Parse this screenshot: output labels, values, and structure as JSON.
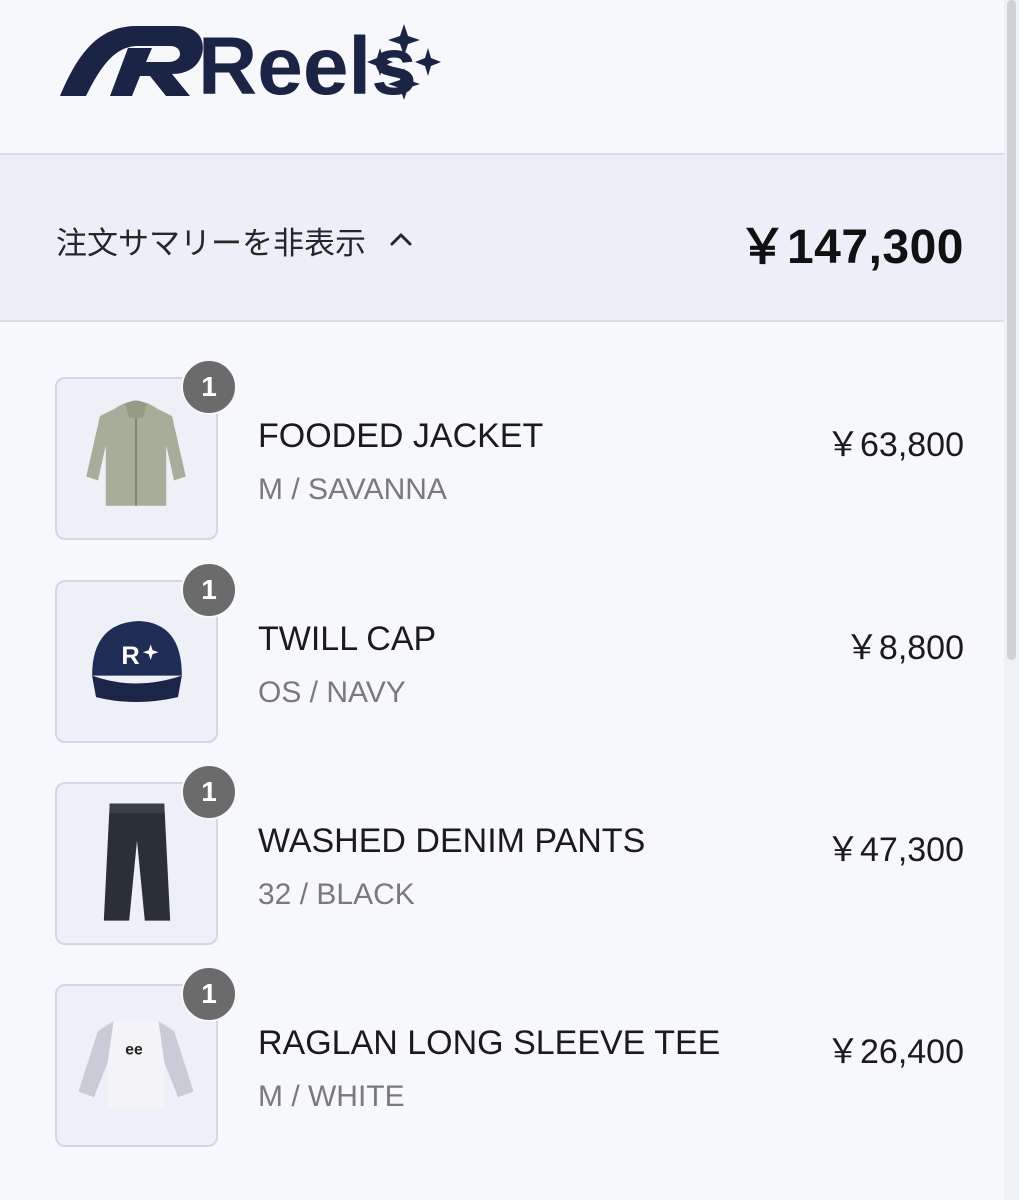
{
  "brand": {
    "name": "Reels",
    "color": "#1c2445"
  },
  "summary": {
    "toggle_label": "注文サマリーを非表示",
    "toggle_icon": "chevron-up-icon",
    "total": "￥147,300"
  },
  "items": [
    {
      "name": "FOODED JACKET",
      "variant": "M / SAVANNA",
      "price": "￥63,800",
      "quantity": "1",
      "image": "jacket-image"
    },
    {
      "name": "TWILL CAP",
      "variant": "OS / NAVY",
      "price": "￥8,800",
      "quantity": "1",
      "image": "cap-image"
    },
    {
      "name": "WASHED DENIM PANTS",
      "variant": "32 / BLACK",
      "price": "￥47,300",
      "quantity": "1",
      "image": "pants-image"
    },
    {
      "name": "RAGLAN LONG SLEEVE TEE",
      "variant": "M / WHITE",
      "price": "￥26,400",
      "quantity": "1",
      "image": "tee-image"
    }
  ]
}
